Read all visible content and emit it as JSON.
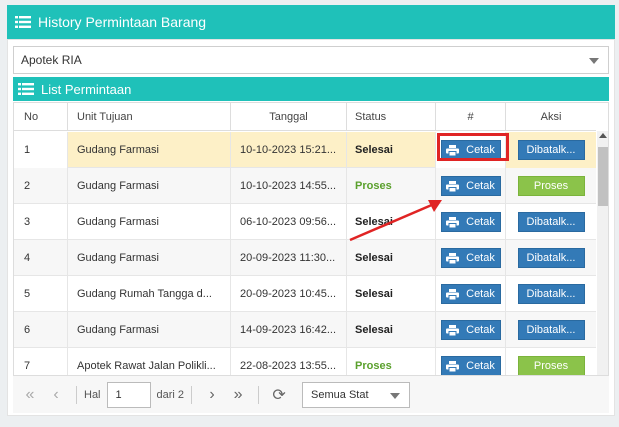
{
  "header": {
    "title": "History Permintaan Barang"
  },
  "apotek_select": {
    "value": "Apotek RIA"
  },
  "list": {
    "title": "List Permintaan"
  },
  "columns": {
    "no": "No",
    "unit": "Unit Tujuan",
    "tanggal": "Tanggal",
    "status": "Status",
    "hash": "#",
    "aksi": "Aksi"
  },
  "rows": [
    {
      "no": "1",
      "unit": "Gudang Farmasi",
      "tanggal": "10-10-2023 15:21...",
      "status": "Selesai",
      "cetak": "Cetak",
      "aksi": "Dibatalk..."
    },
    {
      "no": "2",
      "unit": "Gudang Farmasi",
      "tanggal": "10-10-2023 14:55...",
      "status": "Proses",
      "cetak": "Cetak",
      "aksi": "Proses"
    },
    {
      "no": "3",
      "unit": "Gudang Farmasi",
      "tanggal": "06-10-2023 09:56...",
      "status": "Selesai",
      "cetak": "Cetak",
      "aksi": "Dibatalk..."
    },
    {
      "no": "4",
      "unit": "Gudang Farmasi",
      "tanggal": "20-09-2023 11:30...",
      "status": "Selesai",
      "cetak": "Cetak",
      "aksi": "Dibatalk..."
    },
    {
      "no": "5",
      "unit": "Gudang Rumah Tangga d...",
      "tanggal": "20-09-2023 10:45...",
      "status": "Selesai",
      "cetak": "Cetak",
      "aksi": "Dibatalk..."
    },
    {
      "no": "6",
      "unit": "Gudang Farmasi",
      "tanggal": "14-09-2023 16:42...",
      "status": "Selesai",
      "cetak": "Cetak",
      "aksi": "Dibatalk..."
    },
    {
      "no": "7",
      "unit": "Apotek Rawat Jalan Polikli...",
      "tanggal": "22-08-2023 13:55...",
      "status": "Proses",
      "cetak": "Cetak",
      "aksi": "Proses"
    }
  ],
  "pager": {
    "hal_label": "Hal",
    "page_value": "1",
    "dari_label": "dari 2",
    "status_filter": "Semua Stat"
  },
  "colors": {
    "teal": "#1fc1b9",
    "button_blue": "#337ab7",
    "button_green": "#8bc34a",
    "highlight_red": "#e02424",
    "selected_row": "#fdf0c7"
  },
  "icons": [
    "list-icon",
    "printer-icon",
    "first-page-icon",
    "prev-page-icon",
    "next-page-icon",
    "last-page-icon",
    "refresh-icon",
    "caret-down-icon"
  ]
}
